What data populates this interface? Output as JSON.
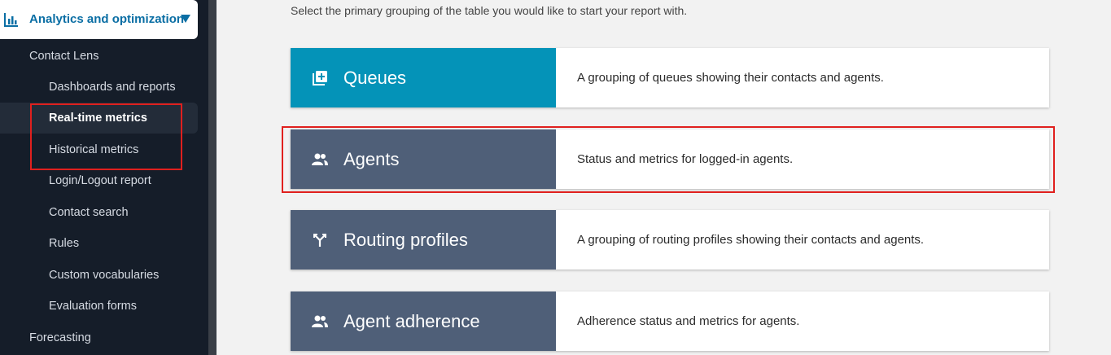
{
  "sidebar": {
    "section_title": "Analytics and optimization",
    "items": [
      {
        "label": "Contact Lens"
      },
      {
        "label": "Dashboards and reports"
      },
      {
        "label": "Real-time metrics"
      },
      {
        "label": "Historical metrics"
      },
      {
        "label": "Login/Logout report"
      },
      {
        "label": "Contact search"
      },
      {
        "label": "Rules"
      },
      {
        "label": "Custom vocabularies"
      },
      {
        "label": "Evaluation forms"
      },
      {
        "label": "Forecasting"
      }
    ]
  },
  "main": {
    "intro": "Select the primary grouping of the table you would like to start your report with.",
    "options": [
      {
        "title": "Queues",
        "description": "A grouping of queues showing their contacts and agents.",
        "icon": "queue-add-icon",
        "color": "#0493b8"
      },
      {
        "title": "Agents",
        "description": "Status and metrics for logged-in agents.",
        "icon": "agents-icon",
        "color": "#4f5f78"
      },
      {
        "title": "Routing profiles",
        "description": "A grouping of routing profiles showing their contacts and agents.",
        "icon": "routing-icon",
        "color": "#4f5f78"
      },
      {
        "title": "Agent adherence",
        "description": "Adherence status and metrics for agents.",
        "icon": "agents-icon",
        "color": "#4f5f78"
      }
    ]
  },
  "colors": {
    "sidebar_bg": "#151d29",
    "accent": "#0a6ea4",
    "highlight": "#e0201e"
  }
}
